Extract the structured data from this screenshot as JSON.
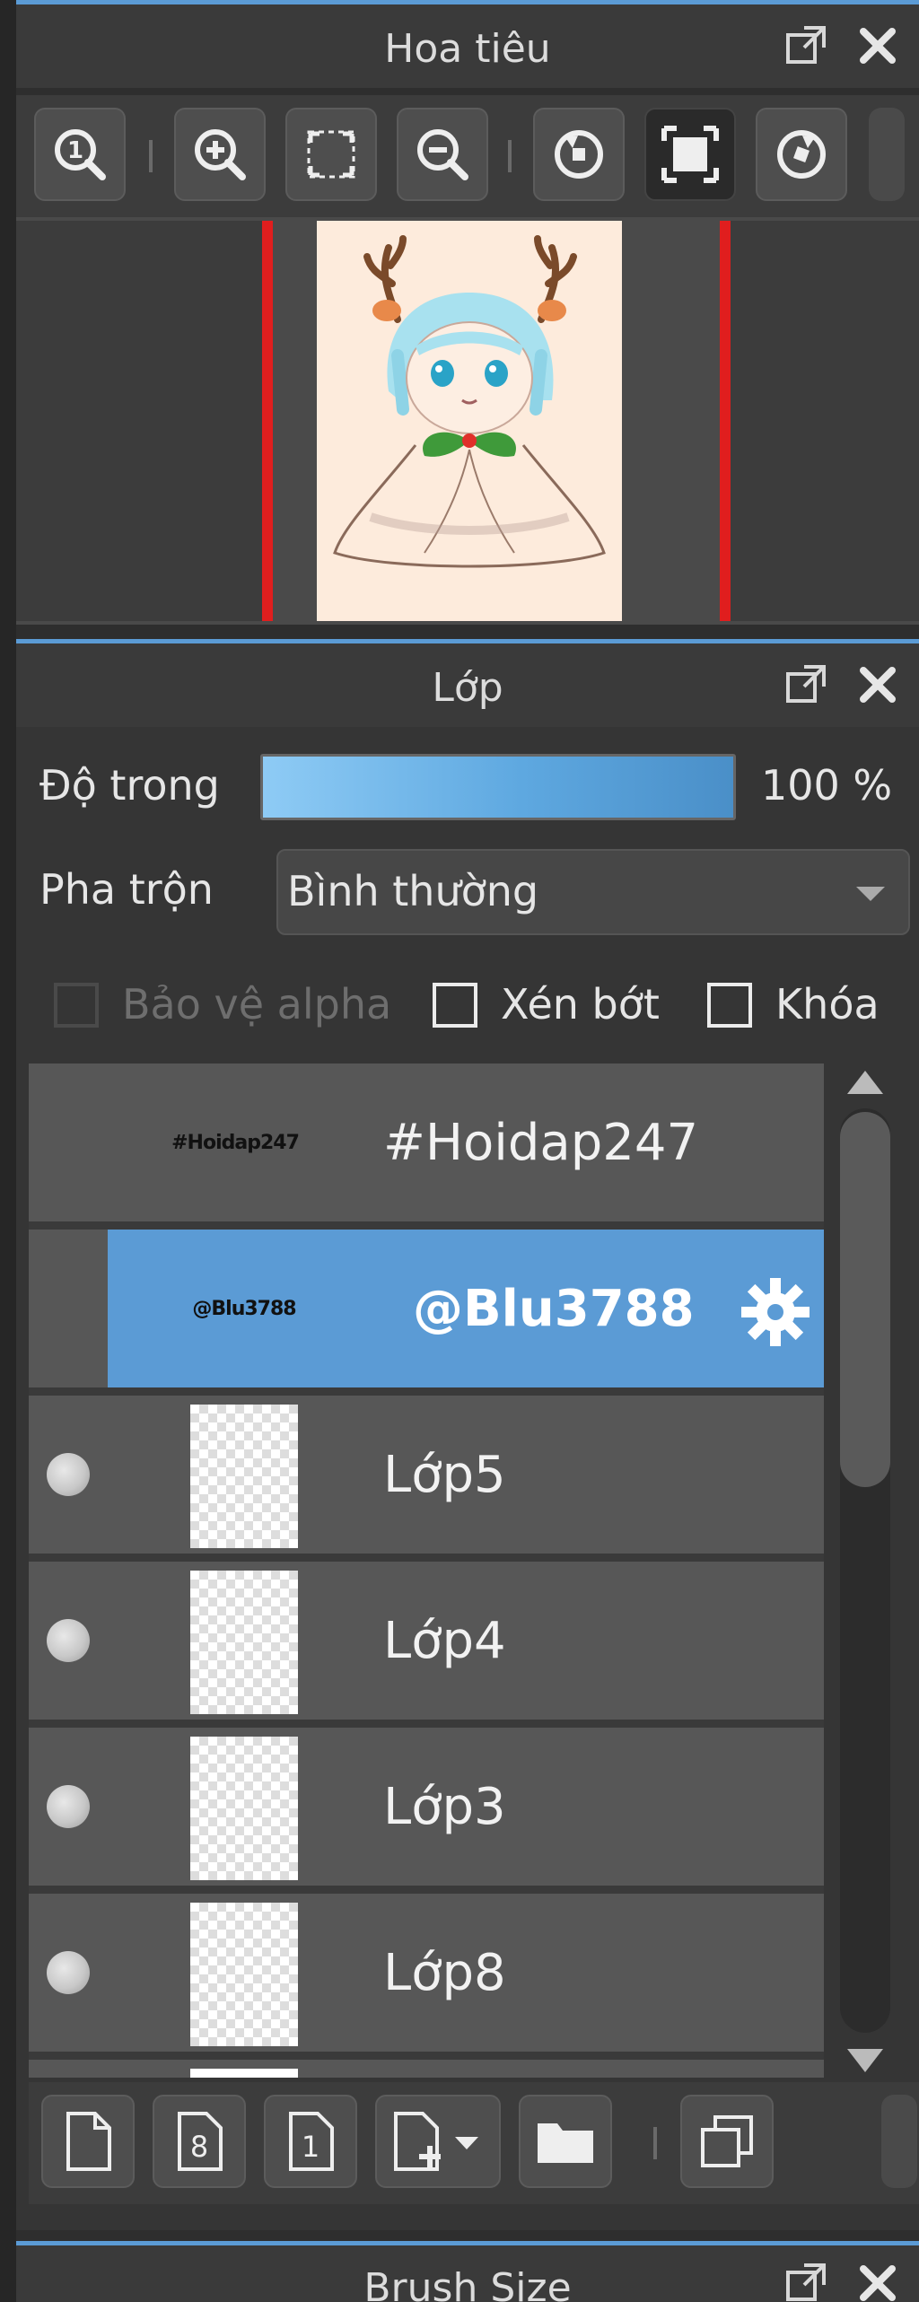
{
  "navigator": {
    "title": "Hoa tiêu",
    "toolbar": [
      "zoom-actual-icon",
      "zoom-in-icon",
      "fit-screen-icon",
      "zoom-out-icon",
      "rotate-left-icon",
      "fit-canvas-icon",
      "rotate-right-icon"
    ]
  },
  "layers": {
    "title": "Lớp",
    "opacity_label": "Độ trong",
    "opacity_value": "100 %",
    "opacity_fraction": 1.0,
    "blend_label": "Pha trộn",
    "blend_value": "Bình thường",
    "protect_alpha_label": "Bảo vệ alpha",
    "clip_label": "Xén bớt",
    "lock_label": "Khóa",
    "items": [
      {
        "name": "#Hoidap247",
        "thumb_text": "#Hoidap247",
        "type": "text"
      },
      {
        "name": "@Blu3788",
        "thumb_text": "@Blu3788",
        "type": "text",
        "selected": true
      },
      {
        "name": "Lớp5",
        "type": "raster"
      },
      {
        "name": "Lớp4",
        "type": "raster"
      },
      {
        "name": "Lớp3",
        "type": "raster"
      },
      {
        "name": "Lớp8",
        "type": "raster"
      }
    ],
    "toolbar": [
      "new-layer-icon",
      "new-8bit-layer-icon",
      "new-1bit-layer-icon",
      "add-layer-menu-icon",
      "new-folder-icon",
      "duplicate-layer-icon"
    ],
    "new_8bit_glyph": "8",
    "new_1bit_glyph": "1"
  },
  "brush_size": {
    "title": "Brush Size"
  },
  "colors": {
    "accent": "#5b9bd5",
    "selected_row": "#5b9bd5",
    "canvas_bg": "#fdebdc"
  }
}
